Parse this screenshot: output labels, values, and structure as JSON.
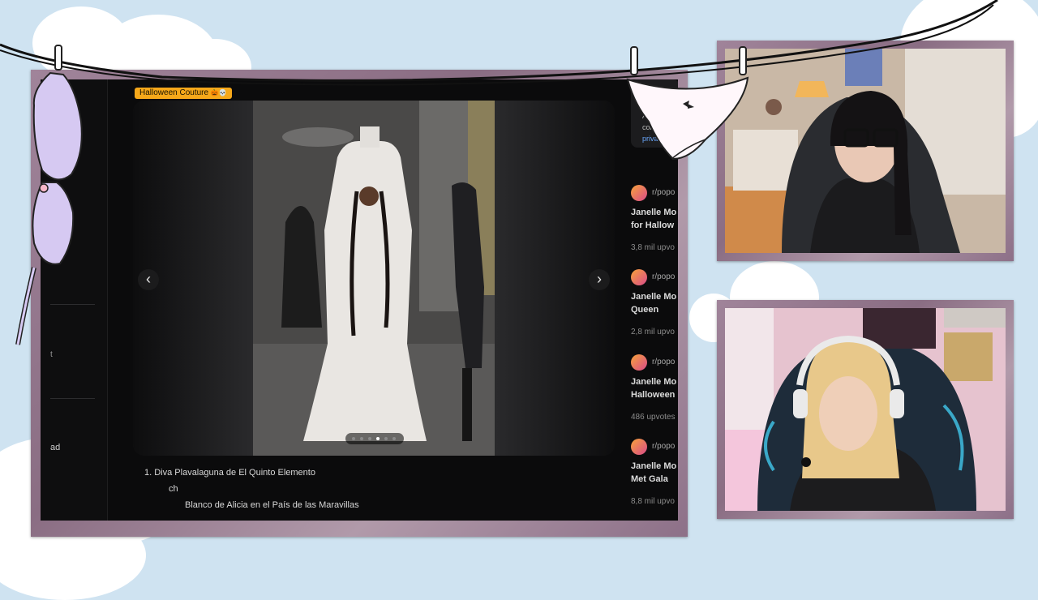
{
  "flair": {
    "label": "Halloween Couture",
    "emoji": "🎃💀"
  },
  "sidebar": {
    "fragment_1": "t",
    "fragment_2": "ad"
  },
  "viewer": {
    "prev_icon": "‹",
    "next_icon": "›"
  },
  "captions": [
    "1. Diva Plavalaguna de El Quinto Elemento",
    "ch",
    "Blanco de Alicia en el País de las Maravillas"
  ],
  "banner_text": [
    "Al co",
    "confi",
    "privac"
  ],
  "posts": [
    {
      "sub": "r/popo",
      "title_1": "Janelle Mo",
      "title_2": "for Hallow",
      "votes": "3,8 mil upvo"
    },
    {
      "sub": "r/popo",
      "title_1": "Janelle Mo",
      "title_2": "Queen",
      "votes": "2,8 mil upvo"
    },
    {
      "sub": "r/popo",
      "title_1": "Janelle Mo",
      "title_2": "Halloween",
      "votes": "486 upvotes"
    },
    {
      "sub": "r/popo",
      "title_1": "Janelle Mo",
      "title_2": "Met Gala",
      "votes": "8,8 mil upvo"
    }
  ],
  "colors": {
    "background": "#cfe3f1",
    "frame": "#9a7e94",
    "flair": "#f6a81a",
    "screen": "#0b0b0c"
  },
  "icons": [
    "chevron-left-icon",
    "chevron-right-icon",
    "bra-sticker-icon",
    "panties-sticker-icon",
    "clothespin-icon"
  ]
}
